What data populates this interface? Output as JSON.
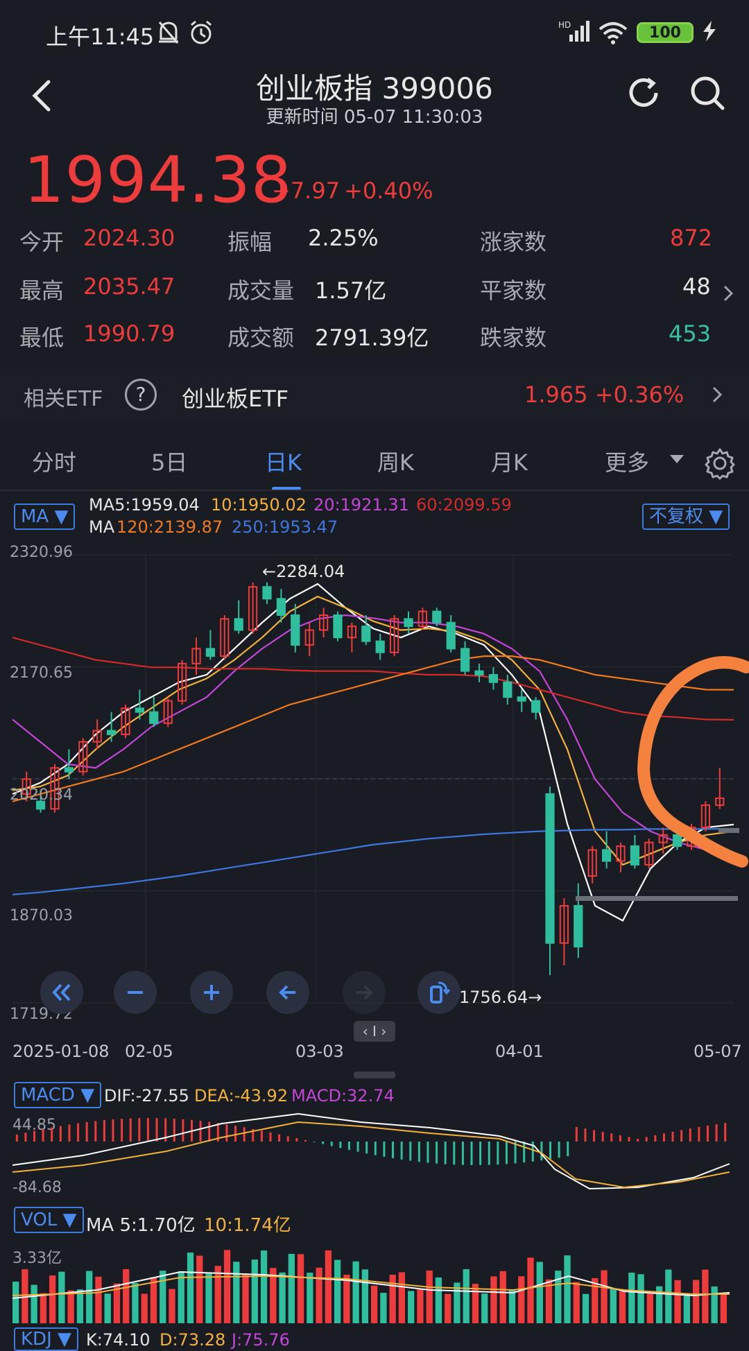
{
  "status": {
    "time": "上午11:45",
    "battery": "100",
    "hd": "HD"
  },
  "header": {
    "title": "创业板指 399006",
    "subtitle": "更新时间 05-07 11:30:03"
  },
  "quote": {
    "price": "1994.38",
    "change": "+7.97",
    "change_pct": "+0.40%",
    "stats": [
      {
        "label": "今开",
        "value": "2024.30"
      },
      {
        "label": "最高",
        "value": "2035.47"
      },
      {
        "label": "最低",
        "value": "1990.79"
      },
      {
        "label": "振幅",
        "value": "2.25%"
      },
      {
        "label": "成交量",
        "value": "1.57亿"
      },
      {
        "label": "成交额",
        "value": "2791.39亿"
      },
      {
        "label": "涨家数",
        "value": "872"
      },
      {
        "label": "平家数",
        "value": "48"
      },
      {
        "label": "跌家数",
        "value": "453"
      }
    ]
  },
  "etf": {
    "label": "相关ETF",
    "help": "?",
    "name": "创业板ETF",
    "value": "1.965 +0.36%"
  },
  "tabs": [
    {
      "label": "分时"
    },
    {
      "label": "5日"
    },
    {
      "label": "日K"
    },
    {
      "label": "周K"
    },
    {
      "label": "月K"
    },
    {
      "label": "更多"
    }
  ],
  "ma": {
    "pill": "MA ▼",
    "ma5": "MA5:1959.04",
    "ma10": "10:1950.02",
    "ma20": "20:1921.31",
    "ma60": "60:2099.59",
    "ma_prefix": "MA",
    "ma120": "120:2139.87",
    "ma250": "250:1953.47",
    "adjust": "不复权 ▼"
  },
  "chart": {
    "y_ticks": [
      "2320.96",
      "2170.65",
      "2020.34",
      "1870.03",
      "1719.72"
    ],
    "dates": [
      "2025-01-08",
      "02-05",
      "03-03",
      "04-01",
      "05-07"
    ],
    "high_label": "←2284.04",
    "low_label": "1756.64→",
    "scroll_handle": "‹ I ›",
    "colors": {
      "up": "#ee3c3c",
      "down": "#2fbf9f",
      "ma5": "#ffffff",
      "ma10": "#f4b23a",
      "ma20": "#c446d8",
      "ma60": "#d42a2a",
      "ma120": "#f07a1c",
      "ma250": "#3f77e0",
      "annotation": "#f5813f"
    }
  },
  "macd": {
    "pill": "MACD ▼",
    "dif": "DIF:-27.55",
    "dea": "DEA:-43.92",
    "macd": "MACD:32.74",
    "y_top": "44.85",
    "y_bottom": "-84.68"
  },
  "vol": {
    "pill": "VOL ▼",
    "ma5": "MA 5:1.70亿",
    "ma10": "10:1.74亿",
    "y_top": "3.33亿"
  },
  "kdj": {
    "pill": "KDJ ▼",
    "k": "K:74.10",
    "d": "D:73.28",
    "j": "J:75.76"
  },
  "chart_data": {
    "type": "candlestick",
    "title": "创业板指 399006",
    "x_range": [
      "2025-01-08",
      "2025-05-07"
    ],
    "ylim": [
      1719.72,
      2320.96
    ],
    "y_ticks": [
      2320.96,
      2170.65,
      2020.34,
      1870.03,
      1719.72
    ],
    "x_ticks": [
      "2025-01-08",
      "02-05",
      "03-03",
      "04-01",
      "05-07"
    ],
    "annotations": [
      {
        "label": "2284.04",
        "value": 2284.04
      },
      {
        "label": "1756.64",
        "value": 1756.64
      }
    ],
    "series": [
      {
        "name": "MA5",
        "values": [
          2000,
          2015,
          2040,
          2080,
          2110,
          2130,
          2150,
          2160,
          2195,
          2230,
          2262,
          2282,
          2250,
          2222,
          2210,
          2225,
          2215,
          2200,
          2160,
          2110,
          1960,
          1850,
          1830,
          1900,
          1935,
          1955,
          1959.04
        ]
      },
      {
        "name": "MA10",
        "values": [
          2005,
          2010,
          2025,
          2060,
          2090,
          2115,
          2140,
          2155,
          2180,
          2210,
          2245,
          2265,
          2250,
          2232,
          2220,
          2222,
          2218,
          2205,
          2180,
          2140,
          2060,
          1950,
          1905,
          1920,
          1935,
          1945,
          1950.02
        ]
      },
      {
        "name": "MA20",
        "values": [
          2100,
          2070,
          2040,
          2035,
          2060,
          2090,
          2110,
          2130,
          2165,
          2195,
          2220,
          2235,
          2240,
          2236,
          2230,
          2230,
          2225,
          2215,
          2195,
          2165,
          2100,
          2020,
          1975,
          1950,
          1935,
          1925,
          1921.31
        ]
      },
      {
        "name": "MA60",
        "values": [
          2210,
          2200,
          2190,
          2180,
          2175,
          2170,
          2170,
          2168,
          2168,
          2168,
          2166,
          2165,
          2165,
          2165,
          2162,
          2160,
          2160,
          2158,
          2150,
          2140,
          2130,
          2120,
          2110,
          2105,
          2103,
          2100,
          2099.59
        ]
      },
      {
        "name": "MA120",
        "values": [
          1990,
          2000,
          2010,
          2020,
          2030,
          2045,
          2060,
          2075,
          2090,
          2105,
          2120,
          2130,
          2140,
          2150,
          2160,
          2170,
          2180,
          2185,
          2185,
          2180,
          2170,
          2160,
          2155,
          2150,
          2145,
          2140,
          2139.87
        ]
      },
      {
        "name": "MA250",
        "values": [
          1865,
          1868,
          1872,
          1876,
          1880,
          1885,
          1890,
          1896,
          1902,
          1908,
          1914,
          1920,
          1926,
          1932,
          1936,
          1940,
          1943,
          1946,
          1948,
          1950,
          1951,
          1952,
          1952,
          1953,
          1953,
          1953,
          1953.47
        ]
      }
    ],
    "candles": [
      {
        "o": 2000,
        "h": 2030,
        "l": 1990,
        "c": 2020
      },
      {
        "o": 1990,
        "h": 2005,
        "l": 1975,
        "c": 1980
      },
      {
        "o": 1980,
        "h": 2040,
        "l": 1975,
        "c": 2035
      },
      {
        "o": 2035,
        "h": 2060,
        "l": 2020,
        "c": 2030
      },
      {
        "o": 2030,
        "h": 2075,
        "l": 2025,
        "c": 2070
      },
      {
        "o": 2070,
        "h": 2100,
        "l": 2060,
        "c": 2085
      },
      {
        "o": 2085,
        "h": 2110,
        "l": 2070,
        "c": 2080
      },
      {
        "o": 2080,
        "h": 2120,
        "l": 2075,
        "c": 2115
      },
      {
        "o": 2115,
        "h": 2140,
        "l": 2100,
        "c": 2110
      },
      {
        "o": 2110,
        "h": 2130,
        "l": 2090,
        "c": 2095
      },
      {
        "o": 2095,
        "h": 2130,
        "l": 2090,
        "c": 2125
      },
      {
        "o": 2125,
        "h": 2180,
        "l": 2120,
        "c": 2175
      },
      {
        "o": 2175,
        "h": 2210,
        "l": 2160,
        "c": 2195
      },
      {
        "o": 2195,
        "h": 2220,
        "l": 2180,
        "c": 2185
      },
      {
        "o": 2185,
        "h": 2240,
        "l": 2180,
        "c": 2235
      },
      {
        "o": 2235,
        "h": 2260,
        "l": 2215,
        "c": 2220
      },
      {
        "o": 2220,
        "h": 2284,
        "l": 2215,
        "c": 2278
      },
      {
        "o": 2278,
        "h": 2284,
        "l": 2255,
        "c": 2262
      },
      {
        "o": 2262,
        "h": 2275,
        "l": 2230,
        "c": 2240
      },
      {
        "o": 2240,
        "h": 2255,
        "l": 2190,
        "c": 2200
      },
      {
        "o": 2200,
        "h": 2230,
        "l": 2185,
        "c": 2220
      },
      {
        "o": 2220,
        "h": 2250,
        "l": 2210,
        "c": 2240
      },
      {
        "o": 2240,
        "h": 2245,
        "l": 2205,
        "c": 2210
      },
      {
        "o": 2210,
        "h": 2230,
        "l": 2190,
        "c": 2225
      },
      {
        "o": 2225,
        "h": 2240,
        "l": 2200,
        "c": 2205
      },
      {
        "o": 2205,
        "h": 2215,
        "l": 2180,
        "c": 2190
      },
      {
        "o": 2190,
        "h": 2240,
        "l": 2185,
        "c": 2235
      },
      {
        "o": 2235,
        "h": 2245,
        "l": 2215,
        "c": 2225
      },
      {
        "o": 2225,
        "h": 2250,
        "l": 2220,
        "c": 2245
      },
      {
        "o": 2245,
        "h": 2250,
        "l": 2225,
        "c": 2230
      },
      {
        "o": 2230,
        "h": 2240,
        "l": 2190,
        "c": 2195
      },
      {
        "o": 2195,
        "h": 2205,
        "l": 2160,
        "c": 2165
      },
      {
        "o": 2165,
        "h": 2175,
        "l": 2150,
        "c": 2160
      },
      {
        "o": 2160,
        "h": 2170,
        "l": 2140,
        "c": 2150
      },
      {
        "o": 2150,
        "h": 2160,
        "l": 2120,
        "c": 2130
      },
      {
        "o": 2130,
        "h": 2140,
        "l": 2110,
        "c": 2125
      },
      {
        "o": 2125,
        "h": 2130,
        "l": 2100,
        "c": 2110
      },
      {
        "o": 2000,
        "h": 2010,
        "l": 1757,
        "c": 1800
      },
      {
        "o": 1800,
        "h": 1860,
        "l": 1770,
        "c": 1850
      },
      {
        "o": 1850,
        "h": 1880,
        "l": 1780,
        "c": 1795
      },
      {
        "o": 1890,
        "h": 1930,
        "l": 1880,
        "c": 1925
      },
      {
        "o": 1925,
        "h": 1950,
        "l": 1900,
        "c": 1910
      },
      {
        "o": 1910,
        "h": 1935,
        "l": 1895,
        "c": 1930
      },
      {
        "o": 1930,
        "h": 1945,
        "l": 1900,
        "c": 1905
      },
      {
        "o": 1905,
        "h": 1940,
        "l": 1900,
        "c": 1935
      },
      {
        "o": 1935,
        "h": 1955,
        "l": 1920,
        "c": 1945
      },
      {
        "o": 1945,
        "h": 1960,
        "l": 1925,
        "c": 1930
      },
      {
        "o": 1930,
        "h": 1960,
        "l": 1925,
        "c": 1955
      },
      {
        "o": 1955,
        "h": 1990,
        "l": 1950,
        "c": 1985
      },
      {
        "o": 1985,
        "h": 2035,
        "l": 1980,
        "c": 1994.38
      }
    ]
  }
}
